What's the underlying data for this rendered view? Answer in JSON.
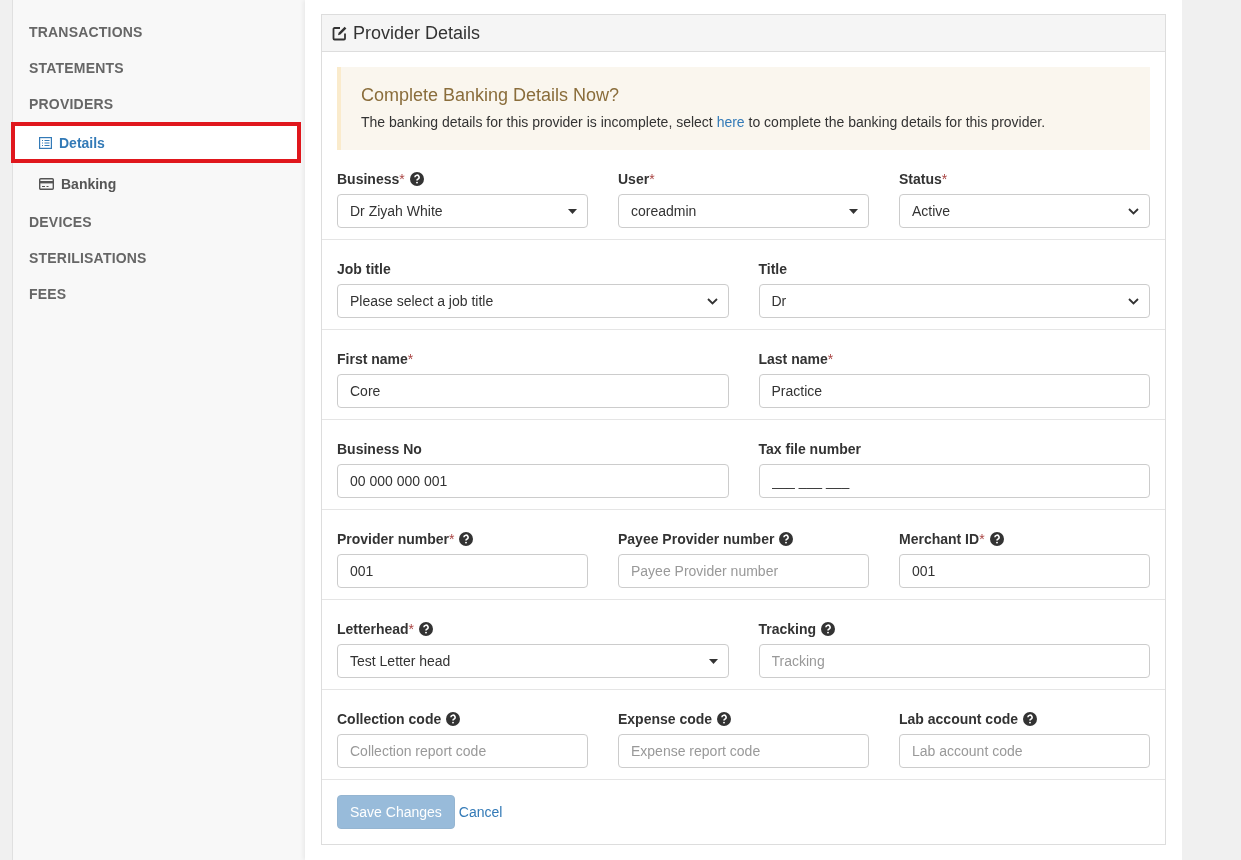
{
  "sidebar": {
    "items": [
      {
        "label": "TRANSACTIONS",
        "selected": false
      },
      {
        "label": "STATEMENTS",
        "selected": false
      },
      {
        "label": "PROVIDERS",
        "selected": false,
        "children": [
          {
            "label": "Details",
            "kind": "list",
            "selected": true,
            "highlighted": true
          },
          {
            "label": "Banking",
            "kind": "card",
            "selected": false,
            "highlighted": false
          }
        ]
      },
      {
        "label": "DEVICES",
        "selected": false
      },
      {
        "label": "STERILISATIONS",
        "selected": false
      },
      {
        "label": "FEES",
        "selected": false
      }
    ]
  },
  "panel": {
    "title": "Provider Details",
    "alert": {
      "heading": "Complete Banking Details Now?",
      "text_before": "The banking details for this provider is incomplete, select",
      "link": "here",
      "text_after": "to complete the banking details for this provider."
    },
    "rows": [
      [
        {
          "label": "Business",
          "required_mark": "*",
          "help": true,
          "kind": "combo",
          "value": "Dr Ziyah White"
        },
        {
          "label": "User",
          "required_mark": "*",
          "help": false,
          "kind": "combo",
          "value": "coreadmin"
        },
        {
          "label": "Status",
          "required_mark": "*",
          "help": false,
          "kind": "select",
          "value": "Active"
        }
      ],
      [
        {
          "label": "Job title",
          "help": false,
          "kind": "select",
          "value": "Please select a job title"
        },
        {
          "label": "Title",
          "help": false,
          "kind": "select",
          "value": "Dr"
        }
      ],
      [
        {
          "label": "First name",
          "required_mark": "*",
          "help": false,
          "kind": "input",
          "value": "Core"
        },
        {
          "label": "Last name",
          "required_mark": "*",
          "help": false,
          "kind": "input",
          "value": "Practice"
        }
      ],
      [
        {
          "label": "Business No",
          "help": false,
          "kind": "input",
          "value": "00 000 000 001"
        },
        {
          "label": "Tax file number",
          "help": false,
          "kind": "input",
          "value": "___ ___ ___"
        }
      ],
      [
        {
          "label": "Provider number",
          "required_mark": "*",
          "help": true,
          "kind": "input",
          "value": "001"
        },
        {
          "label": "Payee Provider number",
          "help": true,
          "kind": "input",
          "placeholder": "Payee Provider number"
        },
        {
          "label": "Merchant ID",
          "required_mark": "*",
          "help": true,
          "kind": "input",
          "value": "001"
        }
      ],
      [
        {
          "label": "Letterhead",
          "required_mark": "*",
          "help": true,
          "kind": "combo",
          "value": "Test Letter head"
        },
        {
          "label": "Tracking",
          "help": true,
          "kind": "input",
          "placeholder": "Tracking"
        }
      ],
      [
        {
          "label": "Collection code",
          "help": true,
          "kind": "input",
          "placeholder": "Collection report code"
        },
        {
          "label": "Expense code",
          "help": true,
          "kind": "input",
          "placeholder": "Expense report code"
        },
        {
          "label": "Lab account code",
          "help": true,
          "kind": "input",
          "placeholder": "Lab account code"
        }
      ]
    ],
    "buttons": {
      "save": {
        "label": "Save Changes",
        "disabled": true
      },
      "cancel": "Cancel"
    }
  }
}
